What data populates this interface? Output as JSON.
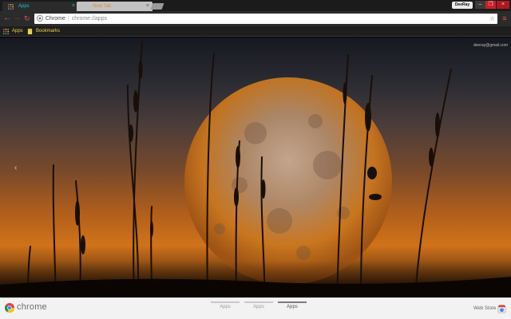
{
  "tabs": [
    {
      "label": "Apps",
      "active": true,
      "close": "×"
    },
    {
      "label": "New Tab",
      "active": false,
      "close": "×"
    }
  ],
  "window": {
    "profile": "DeeRay",
    "minimize": "–",
    "maximize": "❐",
    "close": "×"
  },
  "toolbar": {
    "back": "←",
    "forward": "→",
    "reload": "↻",
    "menu": "≡"
  },
  "omnibox": {
    "origin": "Chrome",
    "separator": "|",
    "url": "chrome://apps",
    "star": "☆"
  },
  "bookmarks": [
    {
      "label": "Apps",
      "icon": "apps-grid-icon"
    },
    {
      "label": "Bookmarks",
      "icon": "bookmark-folder-icon"
    }
  ],
  "ntp": {
    "account": "deeray@gmail.com",
    "prev_arrow": "‹"
  },
  "footer": {
    "logo_text": "chrome",
    "pages": [
      {
        "label": "Apps",
        "active": false
      },
      {
        "label": "Apps",
        "active": false
      },
      {
        "label": "Apps",
        "active": true
      }
    ],
    "webstore": "Web Store"
  },
  "colors": {
    "accent_tab": "#19c3d2",
    "inactive_tab_text": "#e08b2c",
    "nav_red": "#d25b4e",
    "bookmark_text": "#f0d248"
  }
}
